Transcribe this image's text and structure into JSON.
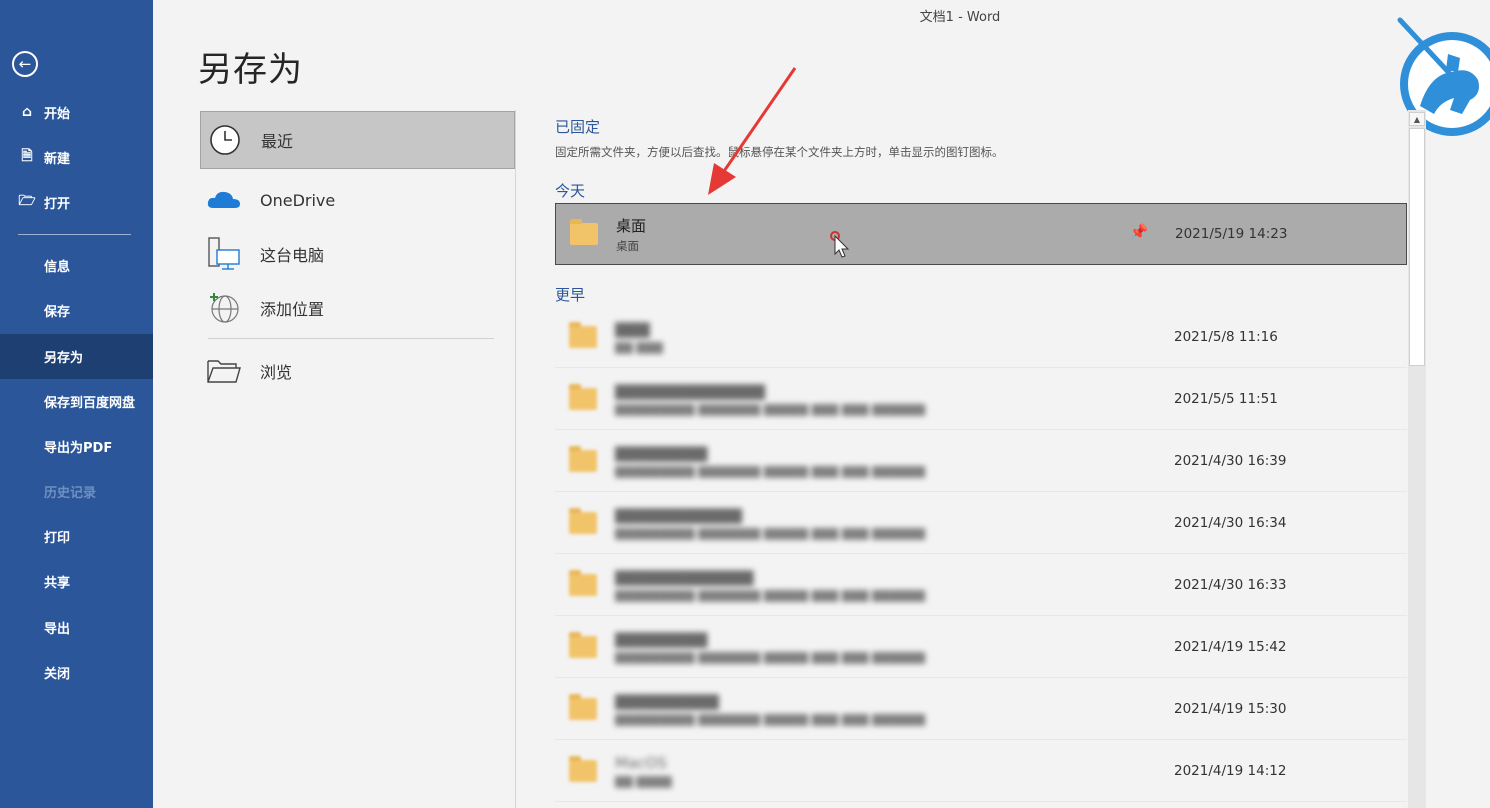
{
  "window": {
    "title": "文档1  -  Word"
  },
  "sidebar": {
    "back_icon": "back-arrow-icon",
    "items": [
      {
        "label": "开始",
        "icon": "home-icon"
      },
      {
        "label": "新建",
        "icon": "new-document-icon"
      },
      {
        "label": "打开",
        "icon": "open-folder-icon"
      },
      {
        "label": "信息"
      },
      {
        "label": "保存"
      },
      {
        "label": "另存为",
        "active": true
      },
      {
        "label": "保存到百度网盘"
      },
      {
        "label": "导出为PDF"
      },
      {
        "label": "历史记录",
        "disabled": true
      },
      {
        "label": "打印"
      },
      {
        "label": "共享"
      },
      {
        "label": "导出"
      },
      {
        "label": "关闭"
      }
    ],
    "colors": {
      "background": "#2b579a",
      "active": "#1e3f72"
    }
  },
  "page": {
    "title": "另存为"
  },
  "locations": {
    "items": [
      {
        "label": "最近",
        "icon": "clock-icon",
        "selected": true
      },
      {
        "label": "OneDrive",
        "icon": "onedrive-cloud-icon"
      },
      {
        "label": "这台电脑",
        "icon": "computer-icon"
      },
      {
        "label": "添加位置",
        "icon": "add-place-globe-icon"
      },
      {
        "label": "浏览",
        "icon": "browse-folder-icon"
      }
    ]
  },
  "recent": {
    "pinned": {
      "heading": "已固定",
      "description": "固定所需文件夹，方便以后查找。鼠标悬停在某个文件夹上方时，单击显示的图钉图标。"
    },
    "today": {
      "heading": "今天",
      "items": [
        {
          "name": "桌面",
          "path": "桌面",
          "date": "2021/5/19 14:23",
          "pin_icon": "pin-icon"
        }
      ]
    },
    "earlier": {
      "heading": "更早",
      "items": [
        {
          "date": "2021/5/8 11:16"
        },
        {
          "date": "2021/5/5 11:51"
        },
        {
          "date": "2021/4/30 16:39"
        },
        {
          "date": "2021/4/30 16:34"
        },
        {
          "date": "2021/4/30 16:33"
        },
        {
          "date": "2021/4/19 15:42"
        },
        {
          "date": "2021/4/19 15:30"
        },
        {
          "name": "MacOS",
          "date": "2021/4/19 14:12"
        }
      ]
    }
  },
  "colors": {
    "accent": "#2b579a",
    "highlight_row": "#ababab",
    "folder": "#f2c46a",
    "annotation_arrow": "#e53935"
  }
}
